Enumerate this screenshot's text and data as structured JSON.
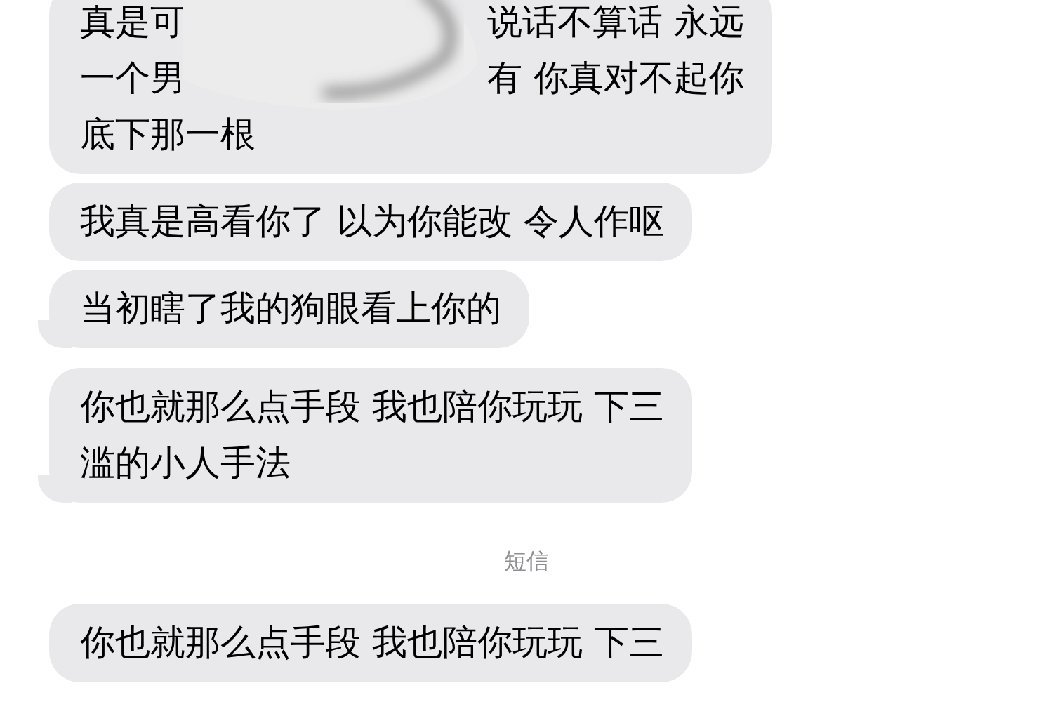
{
  "messages": [
    {
      "kind": "bubble",
      "tail": false,
      "lines": [
        [
          "真是可",
          "说话不算话 永远"
        ],
        [
          "一个男",
          "有 你真对不起你"
        ],
        [
          "底下那一根"
        ]
      ]
    },
    {
      "kind": "bubble",
      "tail": false,
      "lines": [
        [
          "我真是高看你了 以为你能改 令人作呕"
        ]
      ]
    },
    {
      "kind": "bubble",
      "tail": true,
      "lines": [
        [
          "当初瞎了我的狗眼看上你的"
        ]
      ]
    },
    {
      "kind": "bubble",
      "tail": true,
      "lines": [
        [
          "你也就那么点手段 我也陪你玩玩 下三"
        ],
        [
          "滥的小人手法"
        ]
      ]
    },
    {
      "kind": "label",
      "text": "短信"
    },
    {
      "kind": "bubble",
      "tail": false,
      "lines": [
        [
          "你也就那么点手段 我也陪你玩玩 下三"
        ]
      ]
    }
  ]
}
